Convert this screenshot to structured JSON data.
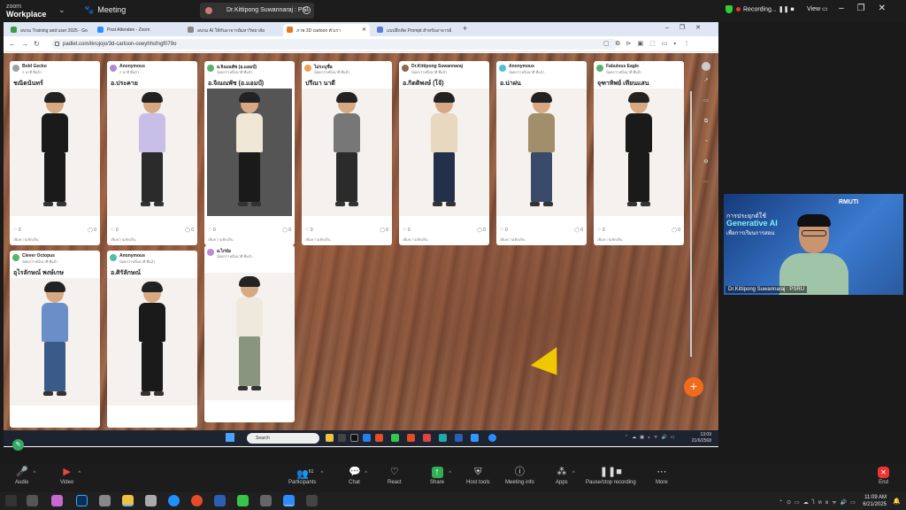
{
  "zoom_top": {
    "logo_line1": "zoom",
    "logo_line2": "Workplace",
    "meeting_label": "Meeting",
    "share_label": "Dr.Kittipong Suwannaraj : PSI",
    "recording_label": "Recording...",
    "view_label": "View"
  },
  "browser": {
    "tabs": [
      {
        "label": "อบรม Training and user 2025 - Go",
        "color": "#3b9b4a"
      },
      {
        "label": "Post Attendee - Zoom",
        "color": "#2d8cff"
      },
      {
        "label": "อบรม AI ให้กับอาจารย์มหาวิทยาลัย",
        "color": "#888888"
      },
      {
        "label": "ภาพ 3D cartoon ตัวเรา",
        "color": "#e07a2b"
      },
      {
        "label": "แบบฝึกหัด Prompt สำหรับอาจารย์",
        "color": "#5a7bd8"
      }
    ],
    "url": "padlet.com/ikrujojo/3d-cartoon-ooeyhhsfngf079o"
  },
  "cards": [
    {
      "author": "Bold Gecko",
      "time": "2 นาที ที่แล้ว",
      "title": "ชณิตนันทร์",
      "likes": "0",
      "comments": "0",
      "comment_hint": "เพิ่มความคิดเห็น",
      "avatar": "#9aa0a6",
      "shirt": "#1a1a1a",
      "pants": "#1a1a1a",
      "bg": "#f4f1ee"
    },
    {
      "author": "Anonymous",
      "time": "2 นาที ที่แล้ว",
      "title": "อ.ประคาย",
      "likes": "0",
      "comments": "0",
      "comment_hint": "เพิ่มความคิดเห็น",
      "avatar": "#b388d8",
      "shirt": "#c8bfe8",
      "pants": "#2b2b2b",
      "bg": "#f4f1ee"
    },
    {
      "author": "อ.จิณณพัช (อ.แอมป์)",
      "time": "น้อยกว่าหนึ่งนาที ที่แล้ว",
      "title": "อ.จิณณพัช (อ.แอมป์)",
      "likes": "0",
      "comments": "0",
      "comment_hint": "เพิ่มความคิดเห็น",
      "avatar": "#58b36a",
      "shirt": "#efe6d6",
      "pants": "#1a1a1a",
      "bg": "#555555"
    },
    {
      "author": "ไม่ระบุชื่อ",
      "time": "น้อยกว่าหนึ่งนาที ที่แล้ว",
      "title": "ปรีณา นาดี",
      "likes": "0",
      "comments": "0",
      "comment_hint": "เพิ่มความคิดเห็น",
      "avatar": "#f0a050",
      "shirt": "#777777",
      "pants": "#2b2b2b",
      "bg": "#f4f1ee"
    },
    {
      "author": "Dr.Kittipong Suwannaraj",
      "time": "น้อยกว่าหนึ่งนาที ที่แล้ว",
      "title": "อ.กิตติพงษ์ (โจ้)",
      "likes": "0",
      "comments": "0",
      "comment_hint": "เพิ่มความคิดเห็น",
      "avatar": "#8a6a50",
      "shirt": "#e8d8c0",
      "pants": "#24304a",
      "bg": "#f4f1ee"
    },
    {
      "author": "Anonymous",
      "time": "น้อยกว่าหนึ่งนาที ที่แล้ว",
      "title": "อ.น่าฝน",
      "likes": "0",
      "comments": "0",
      "comment_hint": "เพิ่มความคิดเห็น",
      "avatar": "#4fc0d8",
      "shirt": "#a08f6a",
      "pants": "#3a4a6a",
      "bg": "#f4f1ee"
    },
    {
      "author": "Fabulous Eagle",
      "time": "น้อยกว่าหนึ่งนาที ที่แล้ว",
      "title": "จุฑาทิพย์ เทียนแสน",
      "likes": "0",
      "comments": "0",
      "comment_hint": "เพิ่มความคิดเห็น",
      "avatar": "#58b36a",
      "shirt": "#1a1a1a",
      "pants": "#1a1a1a",
      "bg": "#f4f1ee"
    },
    {
      "author": "Clever Octopus",
      "time": "น้อยกว่าหนึ่งนาที ที่แล้ว",
      "title": "อุไรลักษณ์ พงษ์เกษ",
      "likes": "",
      "comments": "",
      "comment_hint": "",
      "avatar": "#58b36a",
      "shirt": "#6a8fc8",
      "pants": "#3a5a8a",
      "bg": "#f4f1ee"
    },
    {
      "author": "Anonymous",
      "time": "น้อยกว่าหนึ่งนาที ที่แล้ว",
      "title": "อ.ศิรัลักษณ์",
      "likes": "",
      "comments": "",
      "comment_hint": "",
      "avatar": "#4fc0a8",
      "shirt": "#1a1a1a",
      "pants": "#1a1a1a",
      "bg": "#f4f1ee"
    },
    {
      "author": "อ.ไก่จ๋อ",
      "time": "น้อยกว่าหนึ่งนาที ที่แล้ว",
      "title": "",
      "likes": "",
      "comments": "",
      "comment_hint": "",
      "avatar": "#c088d0",
      "shirt": "#efe8dc",
      "pants": "#8a9580",
      "bg": "#f4f1ee"
    }
  ],
  "inner_taskbar": {
    "search": "Search",
    "time": "13:09",
    "date": "21/6/2568"
  },
  "video": {
    "brand": "RMUTI",
    "slide_line1": "การประยุกต์ใช้",
    "slide_line2": "Generative AI",
    "slide_line3": "เพื่อการเรียนการสอน",
    "name": "Dr.Kittipong Suwannaraj : PSRU"
  },
  "toolbar": {
    "audio": "Audio",
    "video": "Video",
    "participants": "Participants",
    "participants_count": "61",
    "chat": "Chat",
    "react": "React",
    "share": "Share",
    "host_tools": "Host tools",
    "meeting_info": "Meeting info",
    "apps": "Apps",
    "pause_recording": "Pause/stop recording",
    "more": "More",
    "end": "End"
  },
  "os": {
    "time": "11:09 AM",
    "date": "6/21/2025",
    "lang": "ไทย"
  }
}
